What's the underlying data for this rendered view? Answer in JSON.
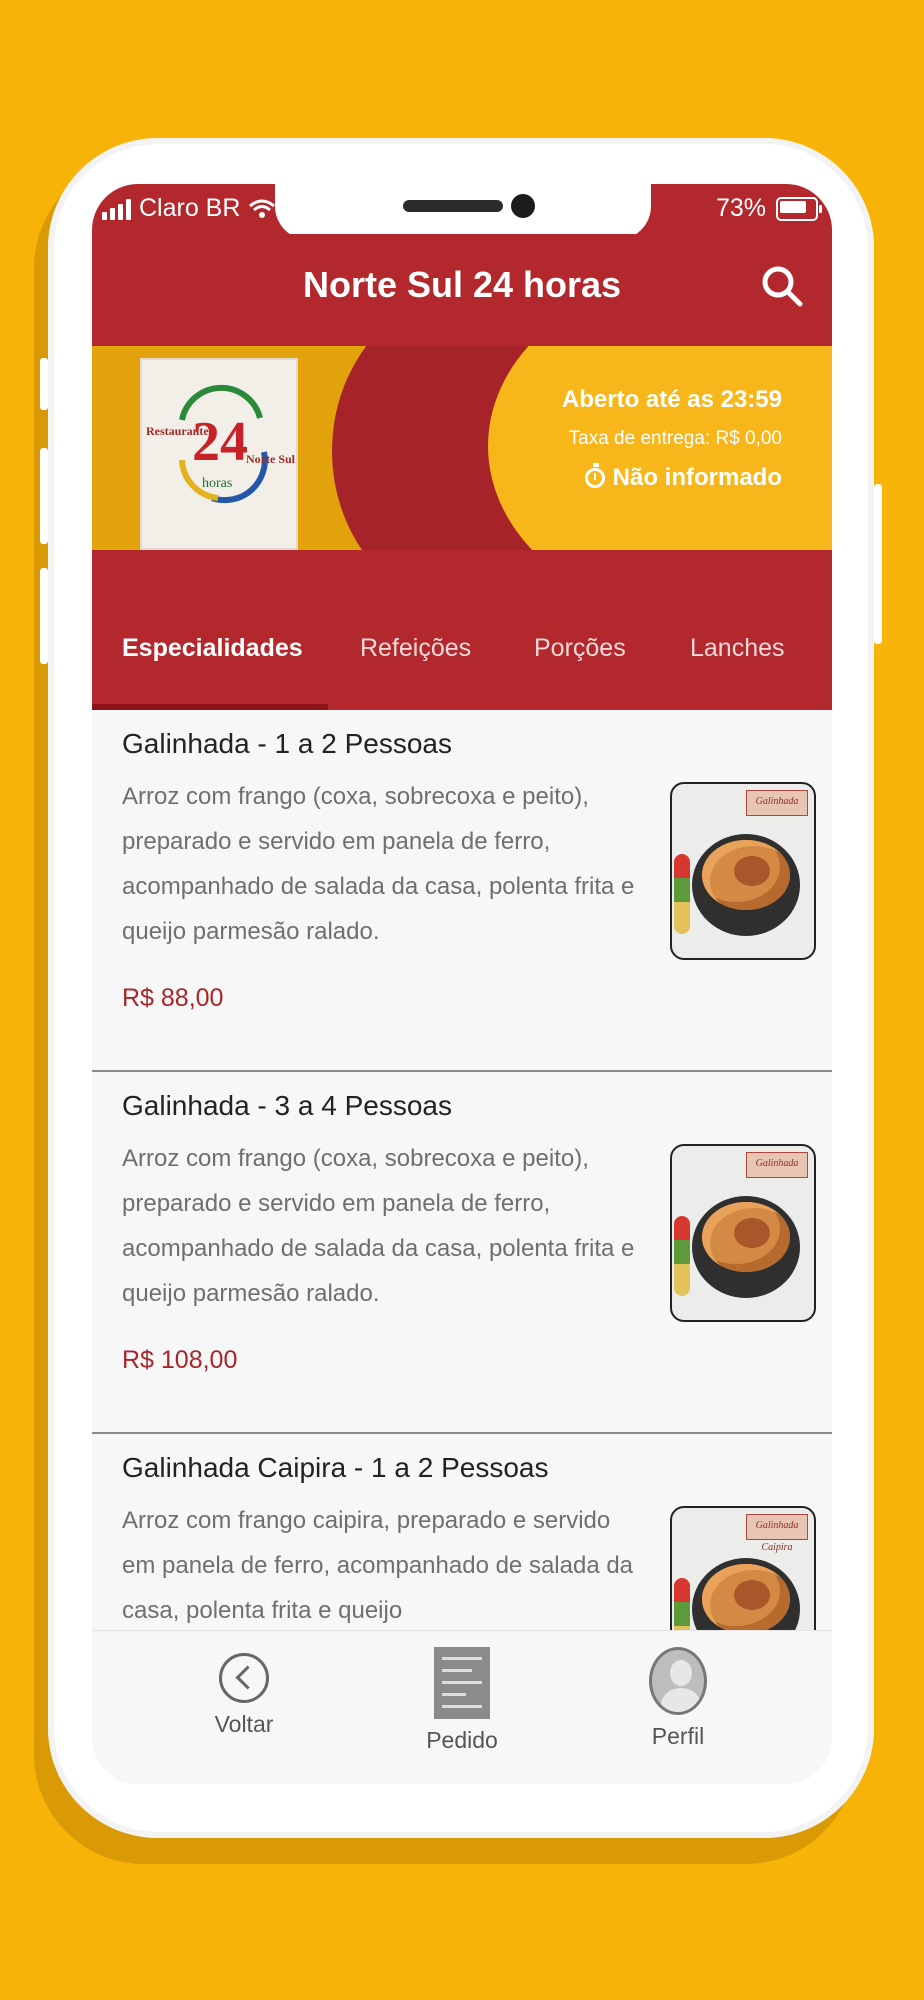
{
  "status_bar": {
    "carrier": "Claro BR",
    "battery": "73%"
  },
  "header": {
    "title": "Norte Sul 24 horas",
    "search_icon": "search-icon"
  },
  "banner": {
    "logo_text_left": "Restaurante",
    "logo_number": "24",
    "logo_text_right": "Norte Sul",
    "logo_text_bottom": "horas",
    "open_until": "Aberto até as 23:59",
    "delivery_fee": "Taxa de entrega: R$ 0,00",
    "time_info": "Não informado",
    "time_icon": "stopwatch-icon"
  },
  "tabs": [
    {
      "label": "Especialidades",
      "active": true
    },
    {
      "label": "Refeições",
      "active": false
    },
    {
      "label": "Porções",
      "active": false
    },
    {
      "label": "Lanches",
      "active": false
    }
  ],
  "menu_items": [
    {
      "title": "Galinhada - 1 a 2 Pessoas",
      "description": "Arroz com frango (coxa, sobrecoxa e peito), preparado e servido em panela de ferro, acompanhado de salada da casa, polenta frita e queijo parmesão ralado.",
      "price": "R$ 88,00",
      "thumb_tag": "Galinhada"
    },
    {
      "title": "Galinhada - 3 a 4 Pessoas",
      "description": "Arroz com frango (coxa, sobrecoxa e peito), preparado e servido em panela de ferro, acompanhado de salada da casa, polenta frita e queijo parmesão ralado.",
      "price": "R$ 108,00",
      "thumb_tag": "Galinhada"
    },
    {
      "title": "Galinhada Caipira - 1 a 2 Pessoas",
      "description": "Arroz com frango caipira, preparado e servido em panela de ferro, acompanhado de salada da casa, polenta frita e queijo",
      "price": "",
      "thumb_tag": "Galinhada Caipira"
    }
  ],
  "bottom_nav": {
    "back_label": "Voltar",
    "order_label": "Pedido",
    "profile_label": "Perfil"
  },
  "colors": {
    "background": "#F8B308",
    "brand_red": "#B3282D",
    "price_red": "#A8262A"
  }
}
